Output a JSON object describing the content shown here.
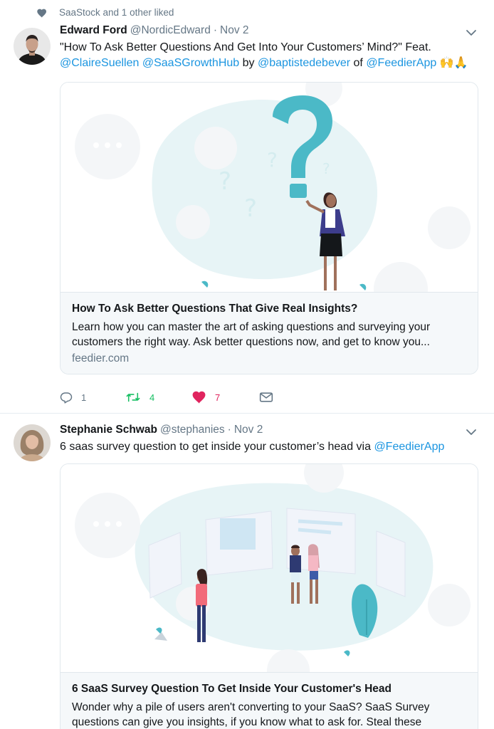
{
  "tweet1": {
    "social_context": "SaaStock and 1 other liked",
    "fullname": "Edward Ford",
    "username": "@NordicEdward",
    "dot": "·",
    "time": "Nov 2",
    "text_before": "\"How To Ask Better Questions And Get Into Your Customers’ Mind?\" Feat. ",
    "mention1": "@ClaireSuellen",
    "mention2": "@SaaSGrowthHub",
    "by": " by ",
    "mention3": "@baptistedebever",
    "of": " of ",
    "mention4": "@FeedierApp",
    "emoji": " 🙌🙏",
    "card": {
      "title": "How To Ask Better Questions That Give Real Insights?",
      "description": "Learn how you can master the art of asking questions and surveying your customers the right way. Ask better questions now, and get to know you...",
      "domain": "feedier.com"
    },
    "actions": {
      "reply_count": "1",
      "retweet_count": "4",
      "like_count": "7"
    }
  },
  "tweet2": {
    "fullname": "Stephanie Schwab",
    "username": "@stephanies",
    "dot": "·",
    "time": "Nov 2",
    "text_before": "6 saas survey question to get inside your customer’s head via ",
    "mention1": "@FeedierApp",
    "card": {
      "title": "6 SaaS Survey Question To Get Inside Your Customer's Head",
      "description": "Wonder why a pile of users aren't converting to your SaaS? SaaS Survey questions can give you insights, if you know what to ask for. Steal these"
    }
  },
  "colors": {
    "link": "#1b95e0",
    "secondary": "#657786",
    "retweet": "#17bf63",
    "like": "#e0245e",
    "illustration_teal": "#4bb9c7"
  }
}
